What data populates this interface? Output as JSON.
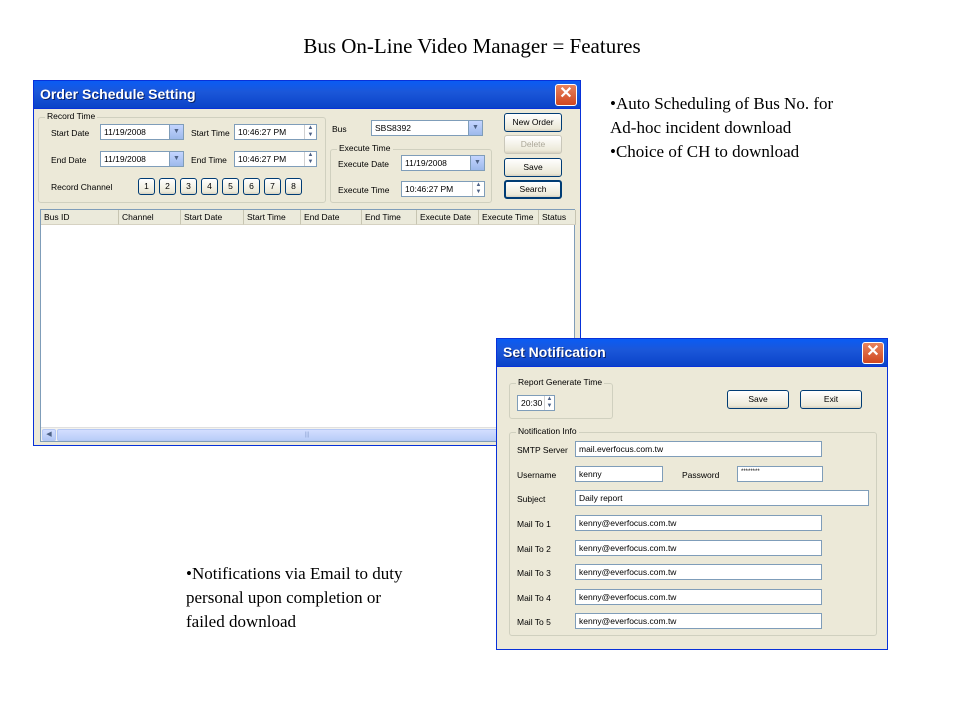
{
  "slide": {
    "title": "Bus On-Line Video Manager  =  Features",
    "bullets_right": [
      "Auto Scheduling of Bus No. for",
      "Ad-hoc incident download",
      "Choice of CH to download"
    ],
    "bullets_left": [
      "Notifications via Email to duty",
      "personal upon completion or",
      "failed download"
    ]
  },
  "order_window": {
    "title": "Order Schedule Setting",
    "close": "✕",
    "record_time_label": "Record Time",
    "start_date_label": "Start Date",
    "start_date": "11/19/2008",
    "start_time_label": "Start Time",
    "start_time": "10:46:27 PM",
    "end_date_label": "End Date",
    "end_date": "11/19/2008",
    "end_time_label": "End Time",
    "end_time": "10:46:27 PM",
    "record_channel_label": "Record Channel",
    "channels": [
      "1",
      "2",
      "3",
      "4",
      "5",
      "6",
      "7",
      "8"
    ],
    "bus_label": "Bus",
    "bus_value": "SBS8392",
    "execute_time_group": "Execute Time",
    "execute_date_label": "Execute Date",
    "execute_date": "11/19/2008",
    "execute_time_label": "Execute Time",
    "execute_time": "10:46:27 PM",
    "buttons": {
      "new_order": "New Order",
      "delete": "Delete",
      "save": "Save",
      "search": "Search"
    },
    "columns": [
      "Bus ID",
      "Channel",
      "Start Date",
      "Start Time",
      "End Date",
      "End Time",
      "Execute Date",
      "Execute Time",
      "Status"
    ],
    "scroll_grip": "|||"
  },
  "notify_window": {
    "title": "Set Notification",
    "close": "✕",
    "report_group": "Report Generate Time",
    "report_time": "20:30",
    "buttons": {
      "save": "Save",
      "exit": "Exit"
    },
    "info_group": "Notification Info",
    "smtp_label": "SMTP Server",
    "smtp_value": "mail.everfocus.com.tw",
    "username_label": "Username",
    "username_value": "kenny",
    "password_label": "Password",
    "password_value": "********",
    "subject_label": "Subject",
    "subject_value": "Daily report",
    "mail_to": [
      {
        "label": "Mail To 1",
        "value": "kenny@everfocus.com.tw"
      },
      {
        "label": "Mail To 2",
        "value": "kenny@everfocus.com.tw"
      },
      {
        "label": "Mail To 3",
        "value": "kenny@everfocus.com.tw"
      },
      {
        "label": "Mail To 4",
        "value": "kenny@everfocus.com.tw"
      },
      {
        "label": "Mail To 5",
        "value": "kenny@everfocus.com.tw"
      }
    ]
  },
  "icons": {
    "dropdown": "chevron-down-icon",
    "spinner": "spinner-arrows-icon",
    "close": "close-icon"
  }
}
